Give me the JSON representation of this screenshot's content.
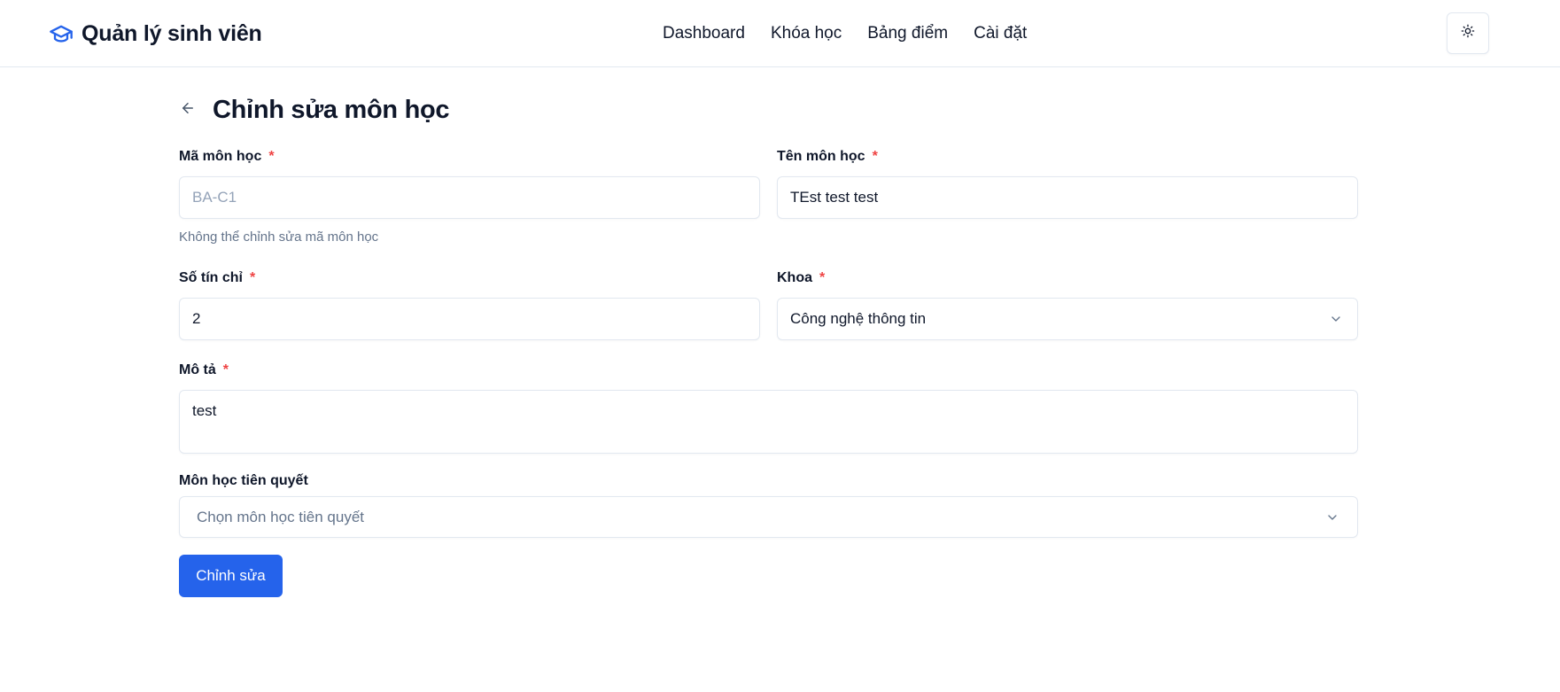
{
  "header": {
    "brand_title": "Quản lý sinh viên",
    "brand_icon": "graduation-cap-icon",
    "nav": [
      {
        "label": "Dashboard"
      },
      {
        "label": "Khóa học"
      },
      {
        "label": "Bảng điểm"
      },
      {
        "label": "Cài đặt"
      }
    ],
    "theme_toggle_icon": "sun-icon"
  },
  "page": {
    "back_icon": "arrow-left-icon",
    "title": "Chỉnh sửa môn học"
  },
  "form": {
    "course_code": {
      "label": "Mã môn học",
      "required_mark": "*",
      "value": "BA-C1",
      "disabled": true,
      "help": "Không thể chỉnh sửa mã môn học"
    },
    "course_name": {
      "label": "Tên môn học",
      "required_mark": "*",
      "value": "TEst test test"
    },
    "credits": {
      "label": "Số tín chỉ",
      "required_mark": "*",
      "value": "2"
    },
    "department": {
      "label": "Khoa",
      "required_mark": "*",
      "selected": "Công nghệ thông tin"
    },
    "description": {
      "label": "Mô tả",
      "required_mark": "*",
      "value": "test"
    },
    "prerequisites": {
      "label": "Môn học tiên quyết",
      "placeholder": "Chọn môn học tiên quyết"
    },
    "submit_label": "Chỉnh sửa"
  },
  "colors": {
    "primary": "#2563eb",
    "required": "#ef4444",
    "muted": "#64748b",
    "border": "#e2e8f0"
  }
}
